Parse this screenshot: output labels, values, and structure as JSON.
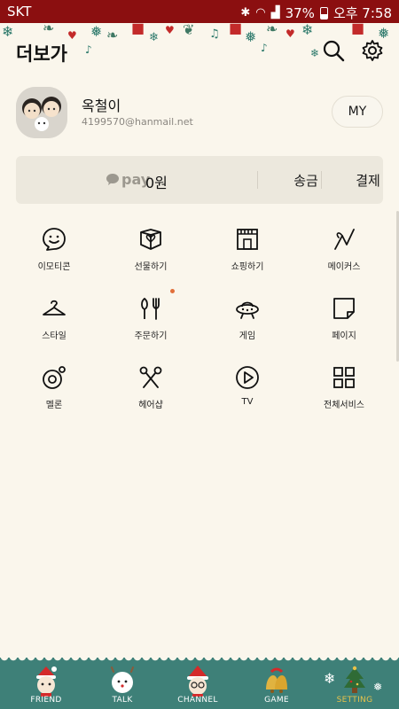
{
  "status_bar": {
    "carrier": "SKT",
    "battery": "37%",
    "time": "오후 7:58"
  },
  "header": {
    "title": "더보가"
  },
  "profile": {
    "name": "옥철이",
    "email": "4199570@hanmail.net",
    "my_label": "MY"
  },
  "pay": {
    "logo": "pay",
    "balance": "0원",
    "transfer": "송금",
    "payment": "결제"
  },
  "menu": [
    {
      "label": "이모티콘",
      "icon": "emoticon-icon"
    },
    {
      "label": "선물하기",
      "icon": "gift-icon"
    },
    {
      "label": "쇼핑하기",
      "icon": "shop-icon"
    },
    {
      "label": "메이커스",
      "icon": "makers-icon"
    },
    {
      "label": "스타일",
      "icon": "hanger-icon"
    },
    {
      "label": "주문하기",
      "icon": "fork-knife-icon"
    },
    {
      "label": "게임",
      "icon": "ufo-icon"
    },
    {
      "label": "페이지",
      "icon": "page-icon"
    },
    {
      "label": "멜론",
      "icon": "melon-icon"
    },
    {
      "label": "헤어샵",
      "icon": "scissors-icon"
    },
    {
      "label": "TV",
      "icon": "play-icon"
    },
    {
      "label": "전체서비스",
      "icon": "grid-icon"
    }
  ],
  "tabs": [
    {
      "label": "FRIEND"
    },
    {
      "label": "TALK"
    },
    {
      "label": "CHANNEL"
    },
    {
      "label": "GAME"
    },
    {
      "label": "SETTING"
    }
  ],
  "colors": {
    "status_bar": "#8b0f10",
    "background": "#faf6ec",
    "tab_bar": "#3e8078",
    "active_tab": "#e8c24a",
    "notification_dot": "#e16f3a"
  }
}
